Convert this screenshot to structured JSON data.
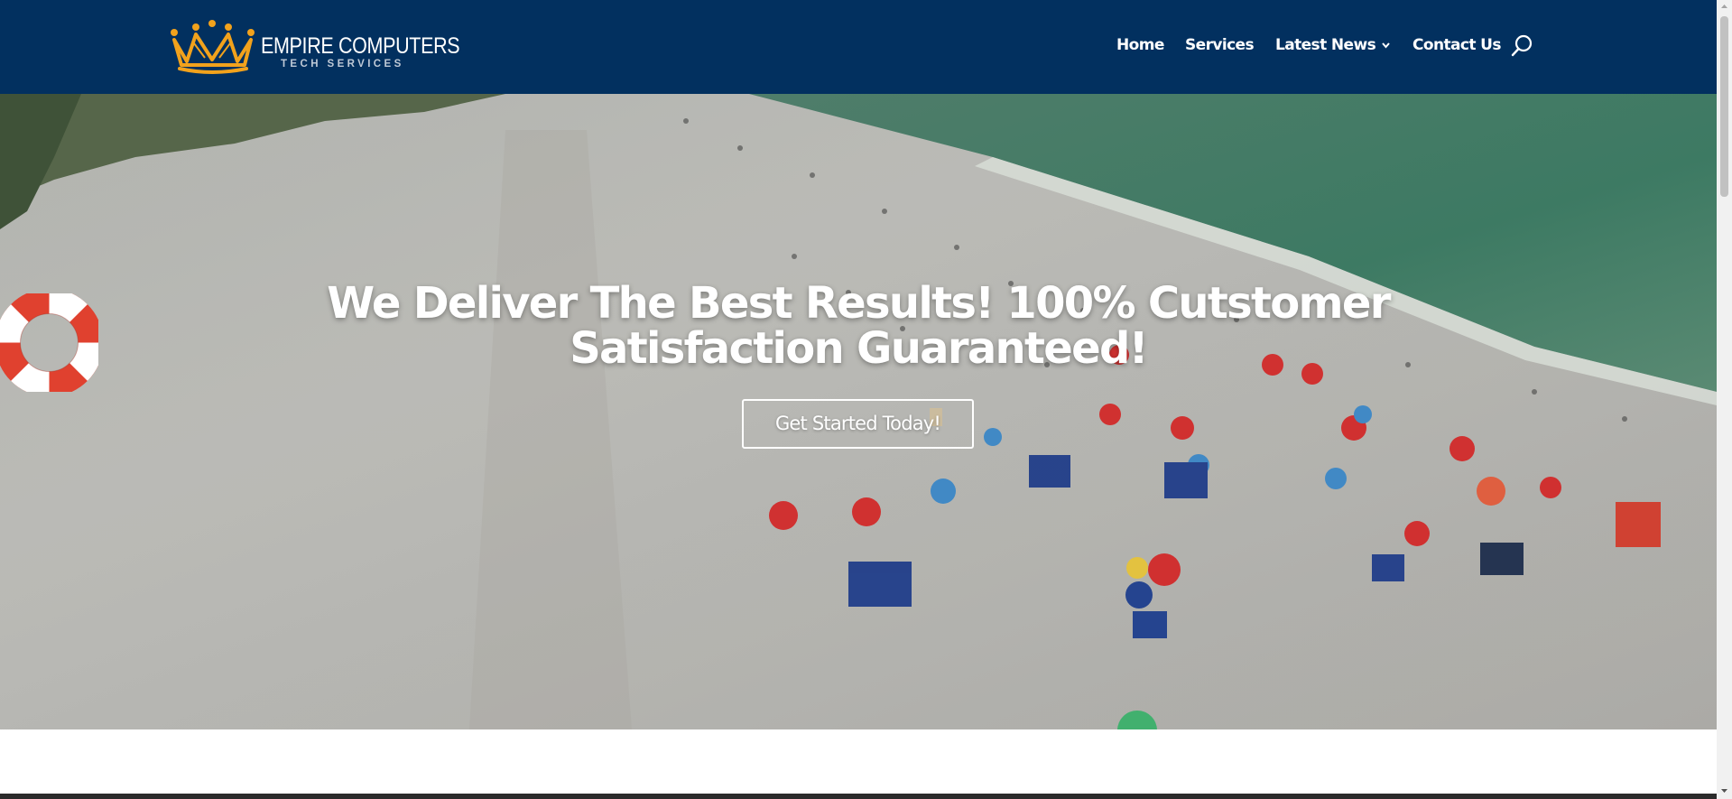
{
  "header": {
    "logo": {
      "title": "EMPIRE COMPUTERS",
      "subtitle": "TECH SERVICES",
      "icon": "crown-icon"
    },
    "nav": [
      {
        "label": "Home"
      },
      {
        "label": "Services"
      },
      {
        "label": "Latest News",
        "icon": "chevron-down-icon"
      },
      {
        "label": "Contact Us"
      }
    ],
    "search_icon": "search-icon"
  },
  "hero": {
    "headline": "We Deliver The Best Results! 100% Cutstomer Satisfaction Guaranteed!",
    "cta_label": "Get Started Today!",
    "background": "aerial beach photo",
    "floating_icon": "lifebuoy-icon"
  },
  "colors": {
    "header_bg": "#02305f",
    "logo_gold": "#f2a21c",
    "lifebuoy_red": "#e0412f"
  }
}
